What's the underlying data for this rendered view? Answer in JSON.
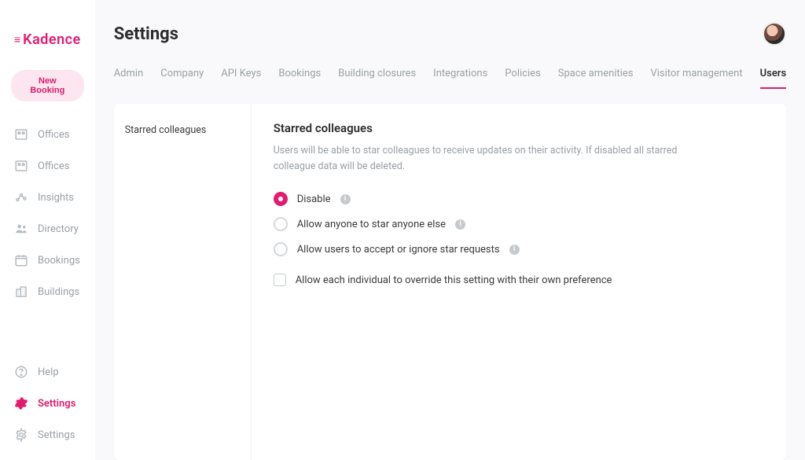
{
  "brand": {
    "name": "Kadence"
  },
  "sidebar": {
    "new_booking_label": "New Booking",
    "items": [
      {
        "label": "Offices"
      },
      {
        "label": "Offices"
      },
      {
        "label": "Insights"
      },
      {
        "label": "Directory"
      },
      {
        "label": "Bookings"
      },
      {
        "label": "Buildings"
      }
    ],
    "bottom": [
      {
        "label": "Help"
      },
      {
        "label": "Settings"
      },
      {
        "label": "Settings"
      }
    ]
  },
  "header": {
    "title": "Settings"
  },
  "tabs": [
    {
      "label": "Admin"
    },
    {
      "label": "Company"
    },
    {
      "label": "API Keys"
    },
    {
      "label": "Bookings"
    },
    {
      "label": "Building closures"
    },
    {
      "label": "Integrations"
    },
    {
      "label": "Policies"
    },
    {
      "label": "Space amenities"
    },
    {
      "label": "Visitor management"
    },
    {
      "label": "Users"
    }
  ],
  "panel": {
    "side_item": "Starred colleagues",
    "section_title": "Starred colleagues",
    "section_desc": "Users will be able to star colleagues to receive updates on their activity. If disabled all starred colleague data will be deleted.",
    "options": [
      {
        "label": "Disable",
        "checked": true,
        "info": true
      },
      {
        "label": "Allow anyone to star anyone else",
        "checked": false,
        "info": true
      },
      {
        "label": "Allow users to accept or ignore star requests",
        "checked": false,
        "info": true
      }
    ],
    "override_label": "Allow each individual to override this setting with their own preference"
  },
  "colors": {
    "accent": "#e31b70"
  }
}
